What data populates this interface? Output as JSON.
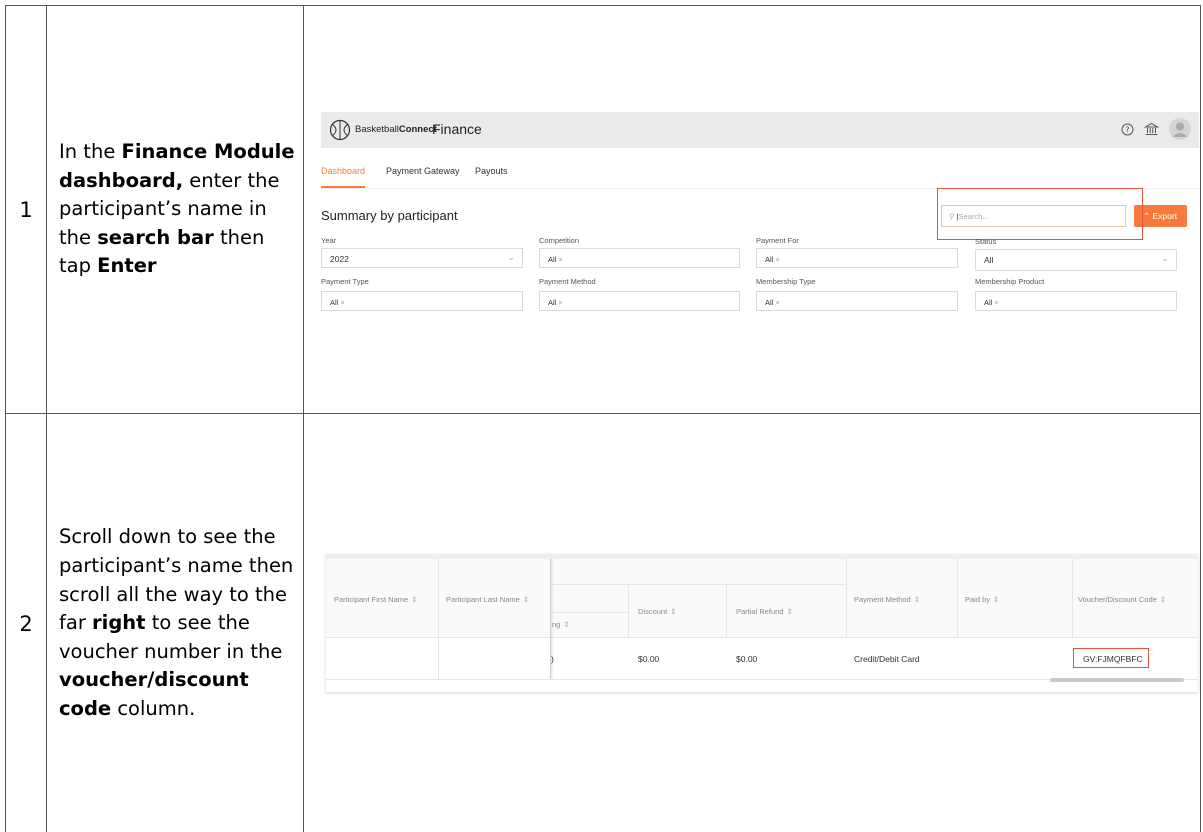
{
  "steps": [
    {
      "number": "1",
      "instruction": [
        {
          "text": "In the ",
          "bold": false
        },
        {
          "text": "Finance Module dashboard,",
          "bold": true
        },
        {
          "text": " enter the participant’s name in the ",
          "bold": false
        },
        {
          "text": "search bar",
          "bold": true
        },
        {
          "text": " then tap ",
          "bold": false
        },
        {
          "text": "Enter",
          "bold": true
        }
      ]
    },
    {
      "number": "2",
      "instruction": [
        {
          "text": "Scroll down to see the participant’s name then scroll all the way to the far ",
          "bold": false
        },
        {
          "text": "right",
          "bold": true
        },
        {
          "text": " to see the voucher number in the ",
          "bold": false
        },
        {
          "text": "voucher/discount code",
          "bold": true
        },
        {
          "text": " column.",
          "bold": false
        }
      ]
    }
  ],
  "screenshot1": {
    "brand_light": "Basketball",
    "brand_bold": "Connect",
    "app_title": "Finance",
    "tabs": [
      "Dashboard",
      "Payment Gateway",
      "Payouts"
    ],
    "active_tab": "Dashboard",
    "section_title": "Summary by participant",
    "search_placeholder": "Search...",
    "export_label": "Export",
    "filters": {
      "year": {
        "label": "Year",
        "value": "2022"
      },
      "competition": {
        "label": "Competition",
        "chip": "All"
      },
      "payment_for": {
        "label": "Payment For",
        "chip": "All"
      },
      "status": {
        "label": "Status",
        "value": "All"
      },
      "payment_type": {
        "label": "Payment Type",
        "chip": "All"
      },
      "payment_method": {
        "label": "Payment Method",
        "chip": "All"
      },
      "membership_type": {
        "label": "Membership Type",
        "chip": "All"
      },
      "membership_product": {
        "label": "Membership Product",
        "chip": "All"
      }
    },
    "accent_color": "#f47b3b",
    "highlight_color": "#e5533d"
  },
  "screenshot2": {
    "columns": {
      "first_name": "Participant First Name",
      "last_name": "Participant Last Name",
      "partial_col": "ng",
      "discount": "Discount",
      "partial_refund": "Partial Refund",
      "payment_method": "Payment Method",
      "paid_by": "Paid by",
      "voucher": "Voucher/Discount Code"
    },
    "row": {
      "partial_value": ")",
      "discount": "$0.00",
      "partial_refund": "$0.00",
      "payment_method": "Credit/Debit Card",
      "paid_by": "",
      "voucher": "GV:FJMQFBFC"
    }
  }
}
